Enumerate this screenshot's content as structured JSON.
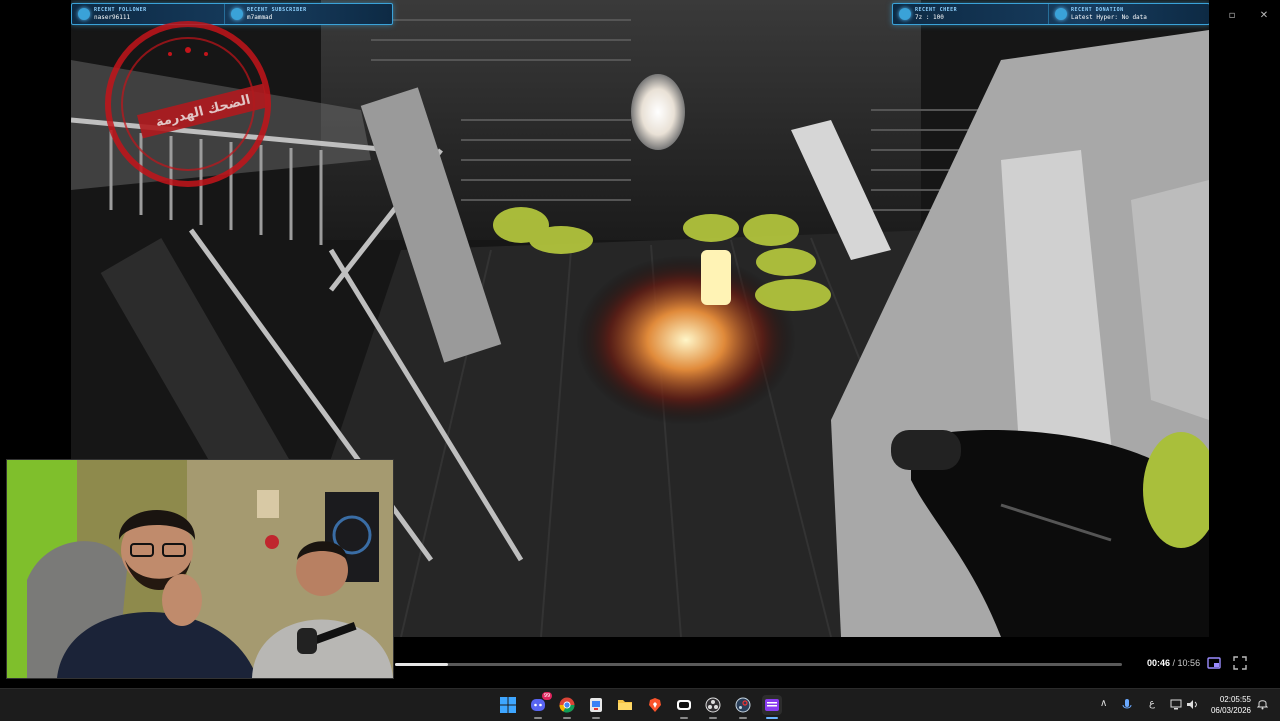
{
  "overlay": {
    "left_bar": {
      "recent_follower_label": "RECENT FOLLOWER",
      "recent_follower_name": "naser96111",
      "recent_subscriber_label": "RECENT SUBSCRIBER",
      "recent_subscriber_name": "m7ammad"
    },
    "right_bar": {
      "recent_cheer_label": "RECENT CHEER",
      "recent_cheer_value": "7z : 100",
      "recent_donation_label": "RECENT DONATION",
      "recent_donation_value": "Latest Hyper: No data"
    }
  },
  "stamp": {
    "text": "الضحك الهدرمة"
  },
  "player": {
    "progress_fraction": 0.073,
    "current_time": "00:46",
    "separator": " / ",
    "total_time": "10:56"
  },
  "taskbar": {
    "apps": [
      {
        "icon": "windows-start-icon"
      },
      {
        "icon": "discord-icon",
        "badge": "99"
      },
      {
        "icon": "chrome-icon"
      },
      {
        "icon": "tablet-app-icon"
      },
      {
        "icon": "file-explorer-icon"
      },
      {
        "icon": "brave-browser-icon"
      },
      {
        "icon": "capcut-icon"
      },
      {
        "icon": "obs-studio-icon"
      },
      {
        "icon": "steam-icon"
      },
      {
        "icon": "stream-app-icon"
      }
    ],
    "tray": {
      "language": "ع",
      "time": "02:05:55",
      "date": "06/03/2026"
    }
  },
  "colors": {
    "overlay_accent": "#3aa2d8",
    "stamp_red": "#b11a1e",
    "taskbar_bg": "#1c1c1c",
    "progress_fill": "#e6e6e6"
  }
}
